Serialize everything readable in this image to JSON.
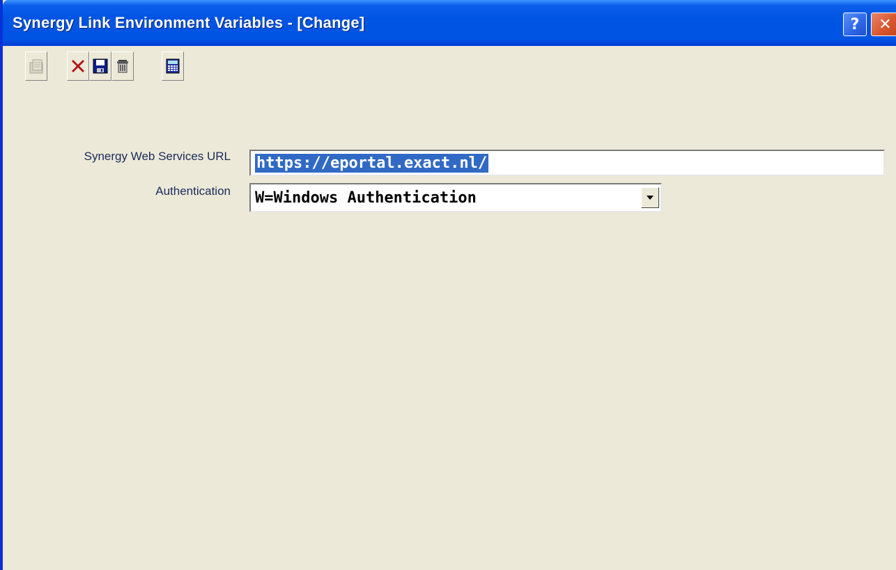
{
  "window": {
    "title": "Synergy Link Environment Variables - [Change]",
    "help_label": "?",
    "close_label": "✕"
  },
  "toolbar": {
    "buttons": [
      {
        "name": "new-document-icon",
        "enabled": false
      },
      {
        "name": "cancel-icon"
      },
      {
        "name": "save-icon"
      },
      {
        "name": "delete-icon"
      },
      {
        "name": "calculator-icon"
      }
    ]
  },
  "form": {
    "url_label": "Synergy Web Services URL",
    "url_value": "https://eportal.exact.nl/",
    "auth_label": "Authentication",
    "auth_value": "W=Windows Authentication"
  },
  "colors": {
    "title_bar": "#0054e3",
    "selection": "#316ac5",
    "window_bg": "#ece9d8",
    "close_button": "#d9572f"
  }
}
